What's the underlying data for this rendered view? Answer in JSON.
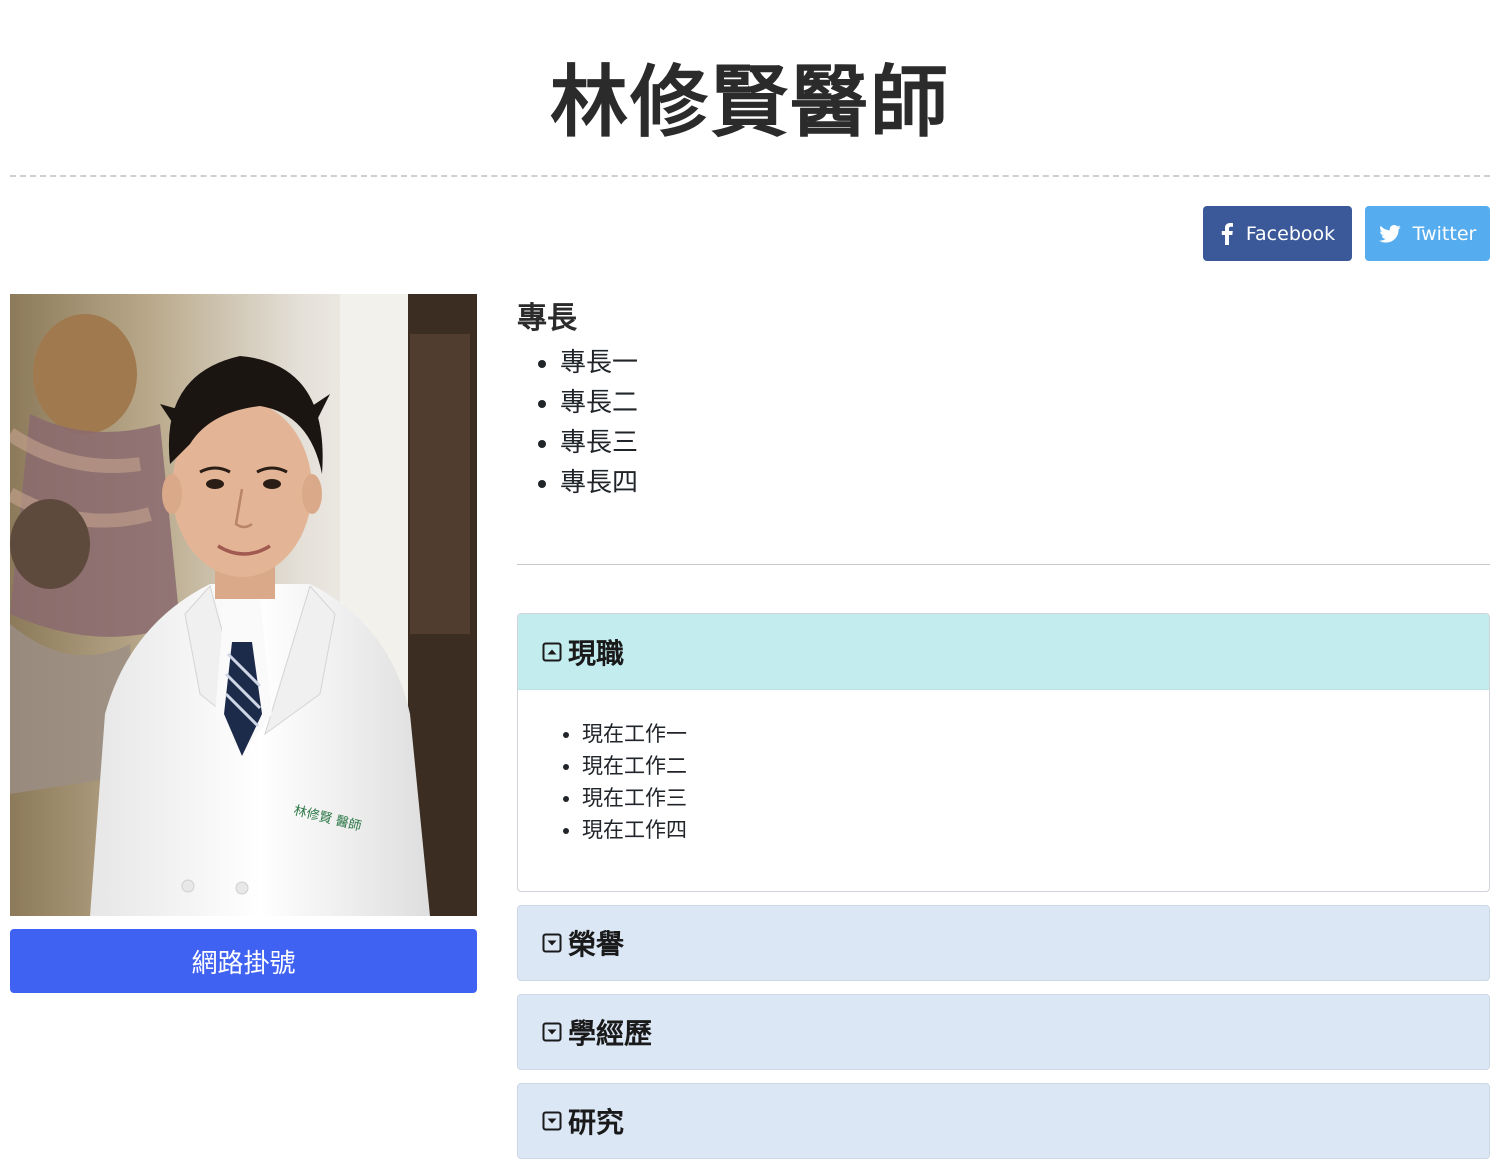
{
  "header": {
    "title": "林修賢醫師"
  },
  "share": {
    "facebook_label": "Facebook",
    "twitter_label": "Twitter",
    "facebook_color": "#3b5998",
    "twitter_color": "#55acee"
  },
  "profile": {
    "photo_icon": "doctor-portrait-photo",
    "register_label": "網路掛號",
    "register_color": "#3f62f3"
  },
  "specialty": {
    "heading": "專長",
    "items": [
      "專長一",
      "專長二",
      "專長三",
      "專長四"
    ]
  },
  "accordion": {
    "panels": [
      {
        "title": "現職",
        "expanded": true,
        "icon": "collapse-up-icon",
        "items": [
          "現在工作一",
          "現在工作二",
          "現在工作三",
          "現在工作四"
        ]
      },
      {
        "title": "榮譽",
        "expanded": false,
        "icon": "expand-down-icon"
      },
      {
        "title": "學經歷",
        "expanded": false,
        "icon": "expand-down-icon"
      },
      {
        "title": "研究",
        "expanded": false,
        "icon": "expand-down-icon"
      }
    ]
  }
}
